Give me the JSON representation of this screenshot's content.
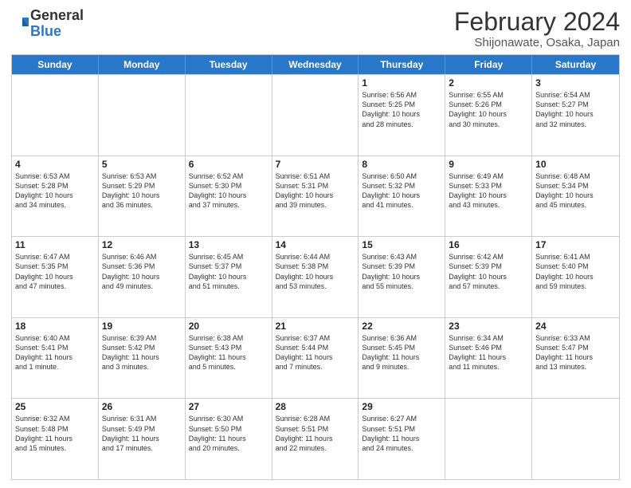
{
  "logo": {
    "general": "General",
    "blue": "Blue"
  },
  "title": "February 2024",
  "subtitle": "Shijonawate, Osaka, Japan",
  "header_days": [
    "Sunday",
    "Monday",
    "Tuesday",
    "Wednesday",
    "Thursday",
    "Friday",
    "Saturday"
  ],
  "weeks": [
    [
      {
        "day": "",
        "info": ""
      },
      {
        "day": "",
        "info": ""
      },
      {
        "day": "",
        "info": ""
      },
      {
        "day": "",
        "info": ""
      },
      {
        "day": "1",
        "info": "Sunrise: 6:56 AM\nSunset: 5:25 PM\nDaylight: 10 hours\nand 28 minutes."
      },
      {
        "day": "2",
        "info": "Sunrise: 6:55 AM\nSunset: 5:26 PM\nDaylight: 10 hours\nand 30 minutes."
      },
      {
        "day": "3",
        "info": "Sunrise: 6:54 AM\nSunset: 5:27 PM\nDaylight: 10 hours\nand 32 minutes."
      }
    ],
    [
      {
        "day": "4",
        "info": "Sunrise: 6:53 AM\nSunset: 5:28 PM\nDaylight: 10 hours\nand 34 minutes."
      },
      {
        "day": "5",
        "info": "Sunrise: 6:53 AM\nSunset: 5:29 PM\nDaylight: 10 hours\nand 36 minutes."
      },
      {
        "day": "6",
        "info": "Sunrise: 6:52 AM\nSunset: 5:30 PM\nDaylight: 10 hours\nand 37 minutes."
      },
      {
        "day": "7",
        "info": "Sunrise: 6:51 AM\nSunset: 5:31 PM\nDaylight: 10 hours\nand 39 minutes."
      },
      {
        "day": "8",
        "info": "Sunrise: 6:50 AM\nSunset: 5:32 PM\nDaylight: 10 hours\nand 41 minutes."
      },
      {
        "day": "9",
        "info": "Sunrise: 6:49 AM\nSunset: 5:33 PM\nDaylight: 10 hours\nand 43 minutes."
      },
      {
        "day": "10",
        "info": "Sunrise: 6:48 AM\nSunset: 5:34 PM\nDaylight: 10 hours\nand 45 minutes."
      }
    ],
    [
      {
        "day": "11",
        "info": "Sunrise: 6:47 AM\nSunset: 5:35 PM\nDaylight: 10 hours\nand 47 minutes."
      },
      {
        "day": "12",
        "info": "Sunrise: 6:46 AM\nSunset: 5:36 PM\nDaylight: 10 hours\nand 49 minutes."
      },
      {
        "day": "13",
        "info": "Sunrise: 6:45 AM\nSunset: 5:37 PM\nDaylight: 10 hours\nand 51 minutes."
      },
      {
        "day": "14",
        "info": "Sunrise: 6:44 AM\nSunset: 5:38 PM\nDaylight: 10 hours\nand 53 minutes."
      },
      {
        "day": "15",
        "info": "Sunrise: 6:43 AM\nSunset: 5:39 PM\nDaylight: 10 hours\nand 55 minutes."
      },
      {
        "day": "16",
        "info": "Sunrise: 6:42 AM\nSunset: 5:39 PM\nDaylight: 10 hours\nand 57 minutes."
      },
      {
        "day": "17",
        "info": "Sunrise: 6:41 AM\nSunset: 5:40 PM\nDaylight: 10 hours\nand 59 minutes."
      }
    ],
    [
      {
        "day": "18",
        "info": "Sunrise: 6:40 AM\nSunset: 5:41 PM\nDaylight: 11 hours\nand 1 minute."
      },
      {
        "day": "19",
        "info": "Sunrise: 6:39 AM\nSunset: 5:42 PM\nDaylight: 11 hours\nand 3 minutes."
      },
      {
        "day": "20",
        "info": "Sunrise: 6:38 AM\nSunset: 5:43 PM\nDaylight: 11 hours\nand 5 minutes."
      },
      {
        "day": "21",
        "info": "Sunrise: 6:37 AM\nSunset: 5:44 PM\nDaylight: 11 hours\nand 7 minutes."
      },
      {
        "day": "22",
        "info": "Sunrise: 6:36 AM\nSunset: 5:45 PM\nDaylight: 11 hours\nand 9 minutes."
      },
      {
        "day": "23",
        "info": "Sunrise: 6:34 AM\nSunset: 5:46 PM\nDaylight: 11 hours\nand 11 minutes."
      },
      {
        "day": "24",
        "info": "Sunrise: 6:33 AM\nSunset: 5:47 PM\nDaylight: 11 hours\nand 13 minutes."
      }
    ],
    [
      {
        "day": "25",
        "info": "Sunrise: 6:32 AM\nSunset: 5:48 PM\nDaylight: 11 hours\nand 15 minutes."
      },
      {
        "day": "26",
        "info": "Sunrise: 6:31 AM\nSunset: 5:49 PM\nDaylight: 11 hours\nand 17 minutes."
      },
      {
        "day": "27",
        "info": "Sunrise: 6:30 AM\nSunset: 5:50 PM\nDaylight: 11 hours\nand 20 minutes."
      },
      {
        "day": "28",
        "info": "Sunrise: 6:28 AM\nSunset: 5:51 PM\nDaylight: 11 hours\nand 22 minutes."
      },
      {
        "day": "29",
        "info": "Sunrise: 6:27 AM\nSunset: 5:51 PM\nDaylight: 11 hours\nand 24 minutes."
      },
      {
        "day": "",
        "info": ""
      },
      {
        "day": "",
        "info": ""
      }
    ]
  ]
}
